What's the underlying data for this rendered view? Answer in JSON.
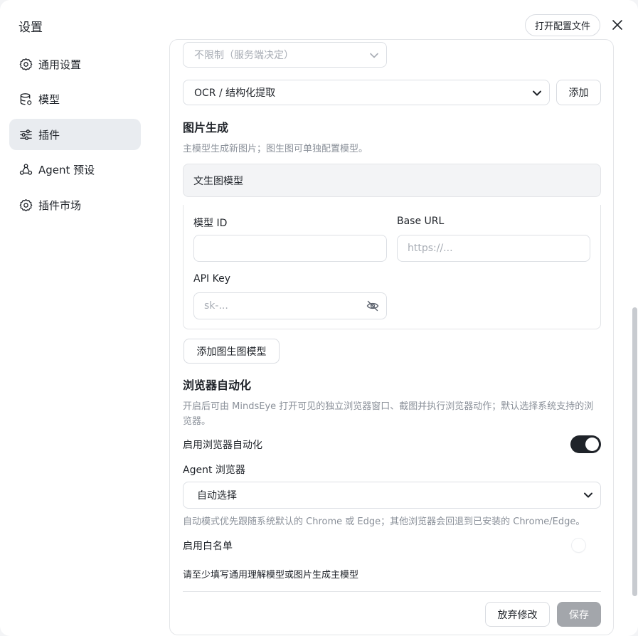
{
  "window": {
    "title": "设置",
    "open_config_label": "打开配置文件"
  },
  "sidebar": {
    "items": [
      {
        "label": "通用设置",
        "icon": "gear-icon"
      },
      {
        "label": "模型",
        "icon": "database-icon"
      },
      {
        "label": "插件",
        "icon": "sliders-icon"
      },
      {
        "label": "Agent 预设",
        "icon": "agent-icon"
      },
      {
        "label": "插件市场",
        "icon": "gear-icon"
      }
    ],
    "active_index": 2
  },
  "content": {
    "limit_select_value": "不限制（服务端决定）",
    "plugin_select_value": "OCR / 结构化提取",
    "add_label": "添加",
    "image_gen": {
      "title": "图片生成",
      "desc": "主模型生成新图片；图生图可单独配置模型。",
      "card_title": "文生图模型",
      "model_id_label": "模型 ID",
      "model_id_value": "",
      "base_url_label": "Base URL",
      "base_url_placeholder": "https://...",
      "api_key_label": "API Key",
      "api_key_placeholder": "sk-...",
      "add_img2img_label": "添加图生图模型"
    },
    "browser": {
      "title": "浏览器自动化",
      "desc": "开启后可由 MindsEye 打开可见的独立浏览器窗口、截图并执行浏览器动作；默认选择系统支持的浏览器。",
      "enable_label": "启用浏览器自动化",
      "enabled": true,
      "agent_browser_label": "Agent 浏览器",
      "agent_browser_value": "自动选择",
      "auto_hint": "自动模式优先跟随系统默认的 Chrome 或 Edge；其他浏览器会回退到已安装的 Chrome/Edge。",
      "whitelist_label": "启用白名单",
      "whitelist_enabled": false
    },
    "warning": "请至少填写通用理解模型或图片生成主模型",
    "discard_label": "放弃修改",
    "save_label": "保存"
  },
  "colors": {
    "toggle_on": "#1f2329",
    "save_disabled": "#a3a6ab",
    "active_bg": "#e9ecf0"
  }
}
